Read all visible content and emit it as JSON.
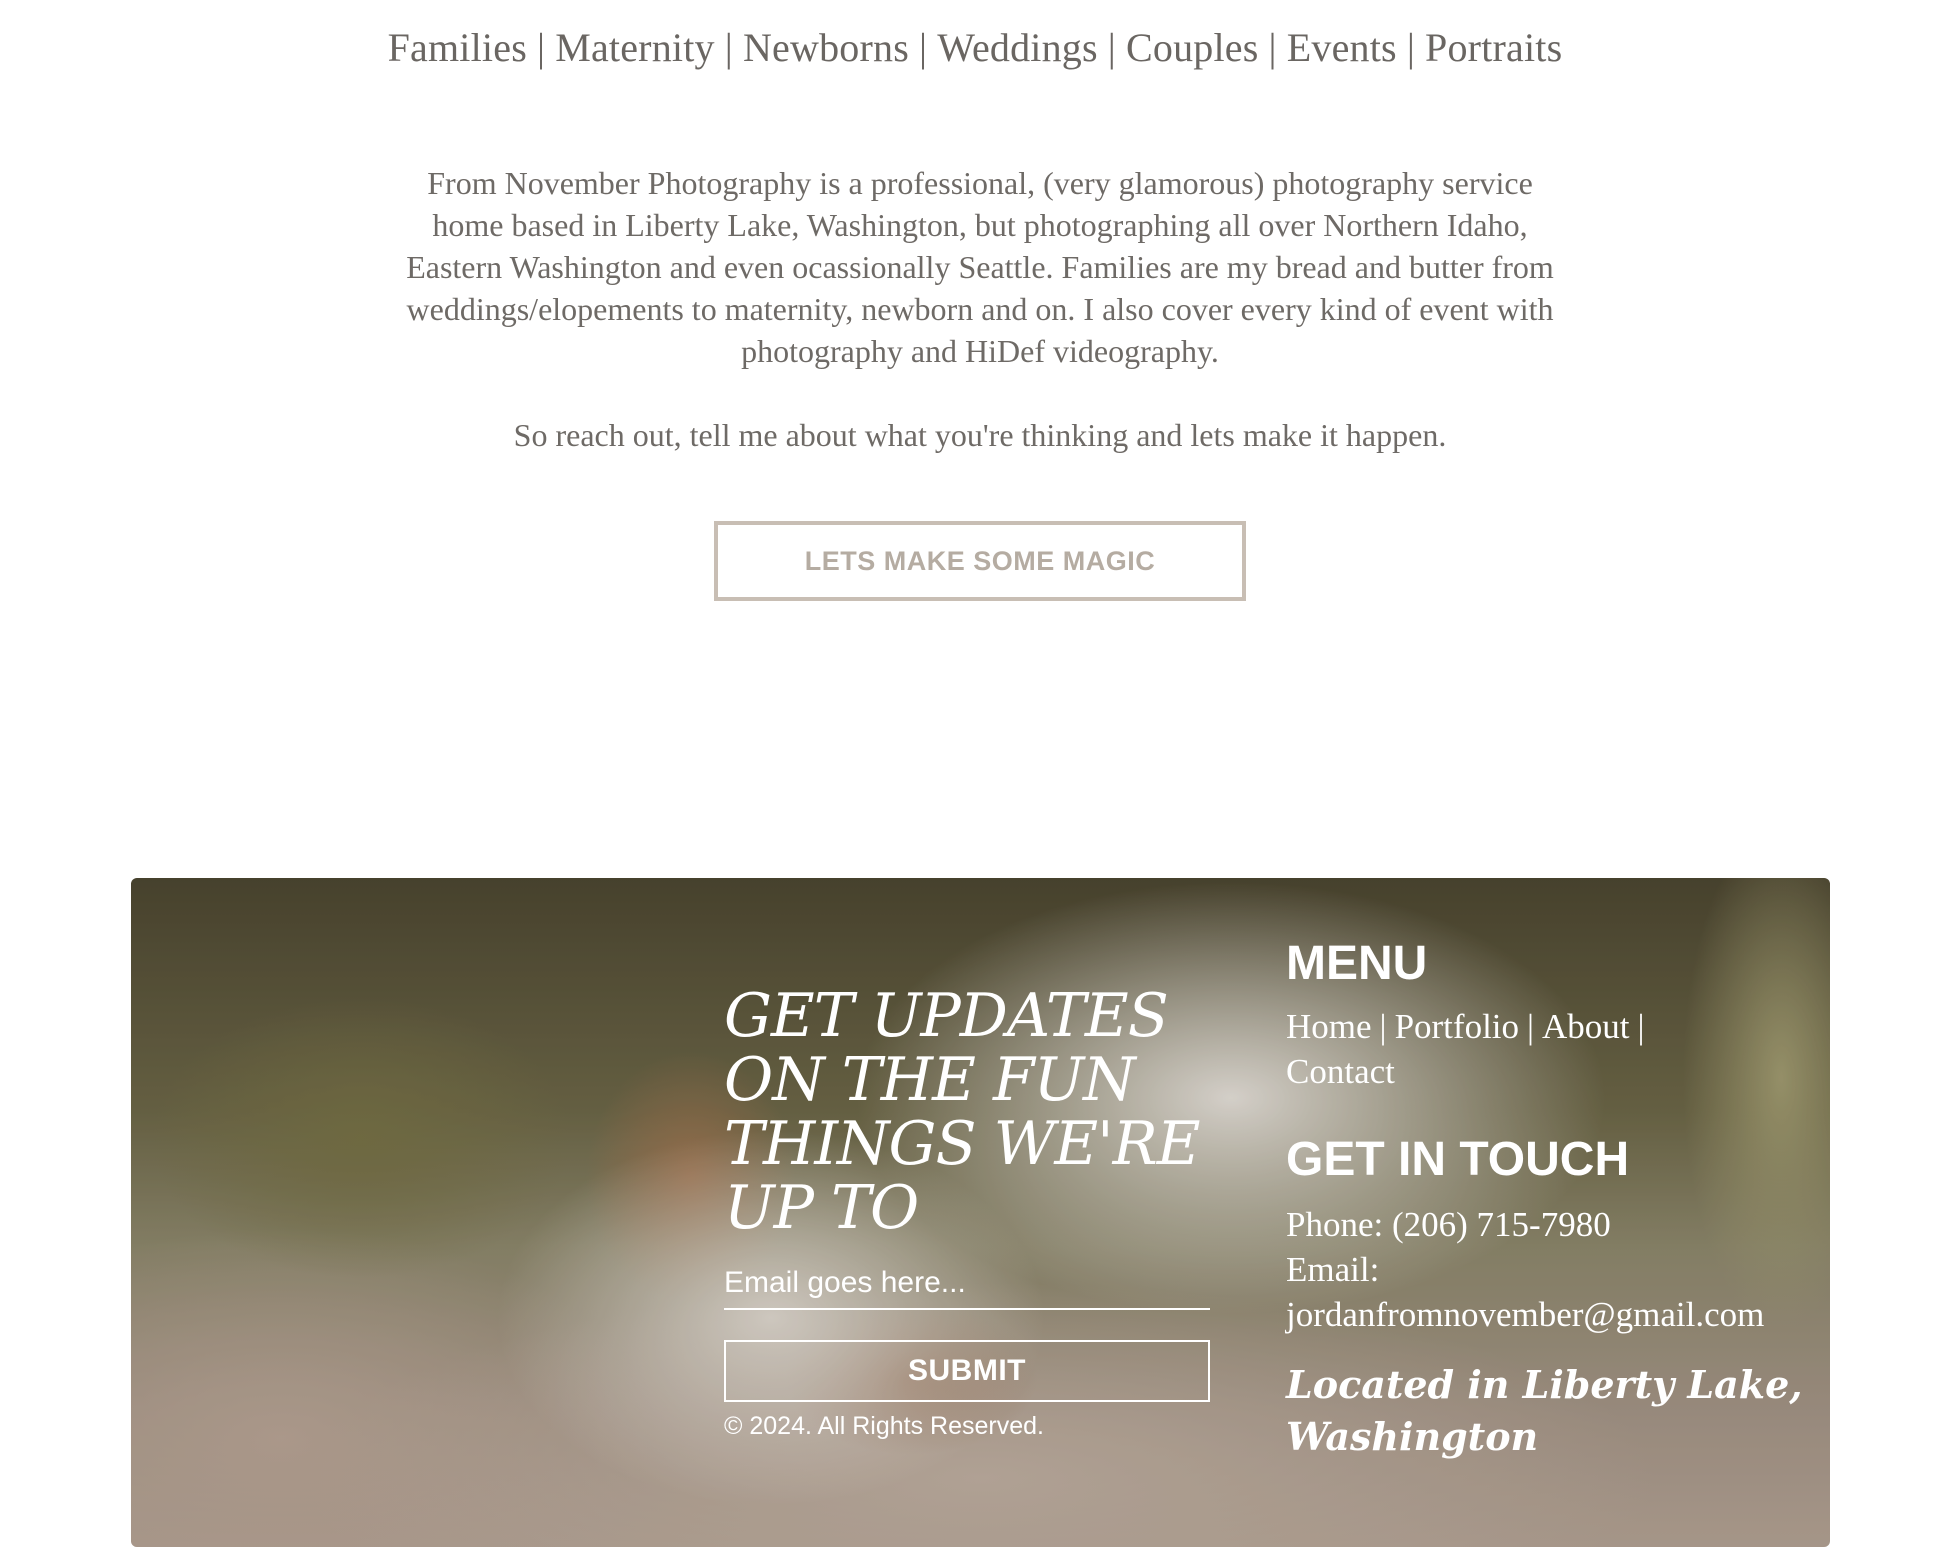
{
  "services_nav": {
    "items": [
      "Families",
      "Maternity",
      "Newborns",
      "Weddings",
      "Couples",
      "Events",
      "Portraits"
    ],
    "separator": "|"
  },
  "intro": {
    "paragraph1": "From November Photography is a professional, (very glamorous) photography service home based in Liberty Lake, Washington, but photographing all over Northern Idaho, Eastern Washington and even ocassionally Seattle. Families are my bread and butter from weddings/elopements to maternity, newborn and on. I also cover every kind of event with photography and HiDef videography.",
    "paragraph2": "So reach out, tell me about what you're thinking and lets make it happen."
  },
  "cta": {
    "label": "LETS MAKE SOME MAGIC"
  },
  "footer": {
    "newsletter": {
      "title": "GET UPDATES ON THE FUN THINGS WE'RE UP TO",
      "email_placeholder": "Email goes here...",
      "submit_label": "SUBMIT",
      "copyright": "© 2024. All Rights Reserved."
    },
    "menu": {
      "heading": "MENU",
      "links": [
        "Home",
        "Portfolio",
        "About",
        "Contact"
      ],
      "separator": "|"
    },
    "contact": {
      "heading": "GET IN TOUCH",
      "phone": "Phone: (206) 715-7980",
      "email_label": "Email:",
      "email": "jordanfromnovember@gmail.com",
      "location": "Located in Liberty Lake, Washington"
    },
    "background_image": "dog-on-fluffy-rug"
  },
  "colors": {
    "text": "#6e6a66",
    "button_border": "#c8beb4",
    "button_text": "#b5aca2",
    "footer_text": "#ffffff"
  }
}
